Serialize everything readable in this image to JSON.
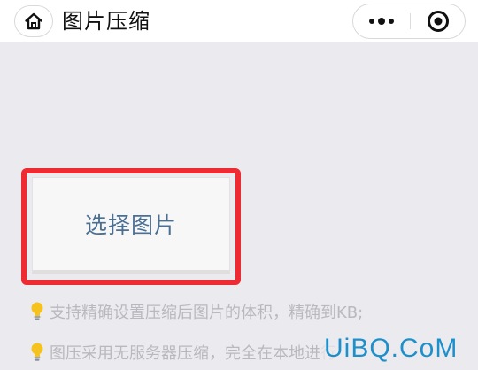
{
  "header": {
    "title": "图片压缩",
    "icons": {
      "home": "home-icon",
      "more": "more-dots-icon",
      "close": "target-close-icon"
    }
  },
  "main": {
    "select_button_label": "选择图片",
    "tips": [
      "支持精确设置压缩后图片的体积，精确到KB;",
      "图压采用无服务器压缩，完全在本地进行"
    ],
    "tip_icon": "lightbulb-icon"
  },
  "watermark": "UiBQ.CoM",
  "colors": {
    "highlight": "#ee2b33",
    "button_text": "#4b6f92",
    "tip_text": "#b8b8be",
    "watermark": "#1d8fcb",
    "background": "#ebebef"
  }
}
